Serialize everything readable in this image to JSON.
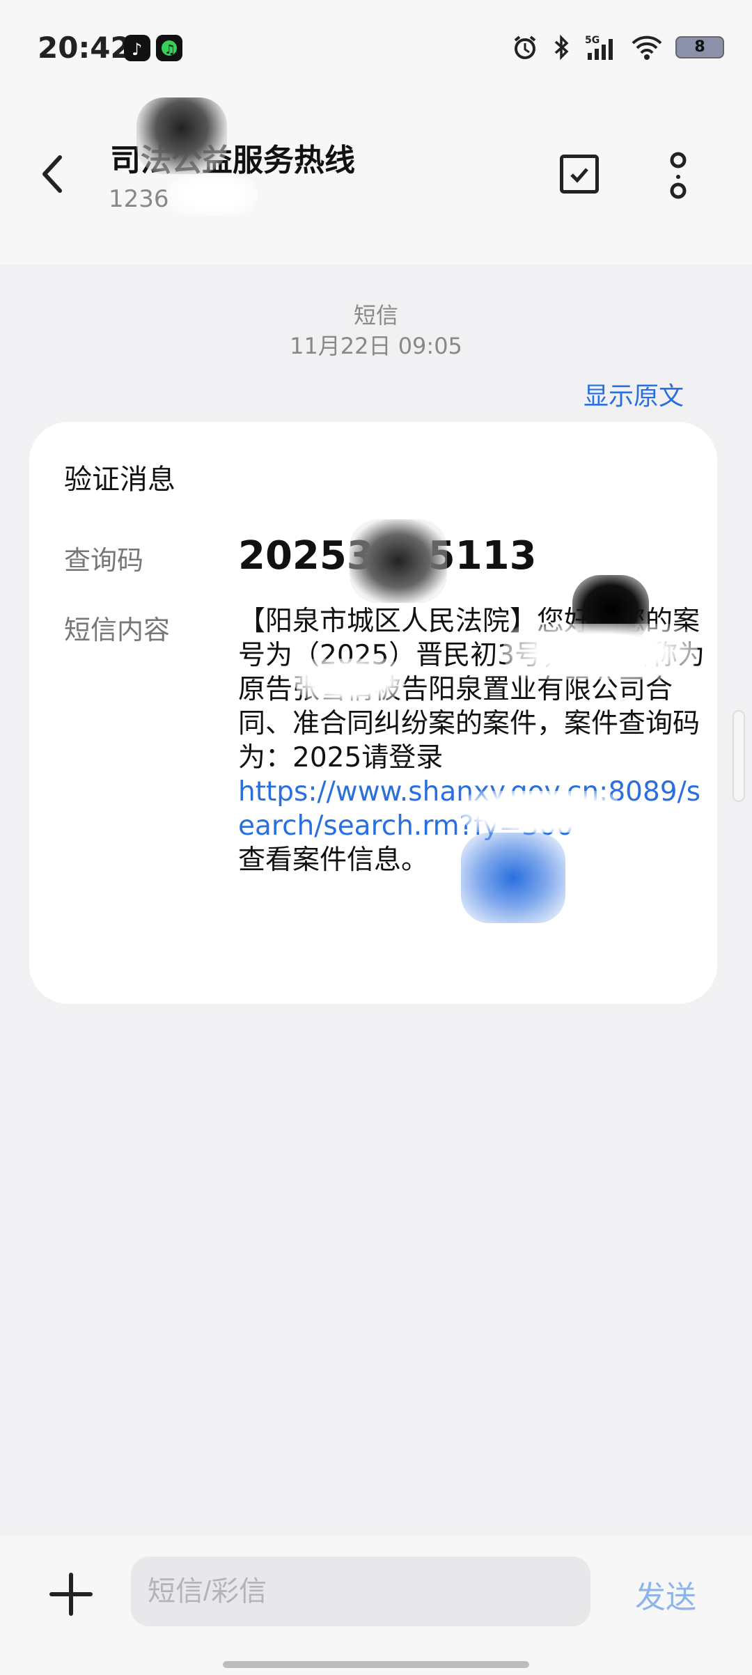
{
  "status_bar": {
    "time": "20:42",
    "battery": "8",
    "icons": [
      "tiktok-app-icon",
      "music-app-icon",
      "alarm-icon",
      "bluetooth-icon",
      "5g-signal-icon",
      "wifi-icon",
      "battery-icon"
    ]
  },
  "header": {
    "title": "司法公益服务热线",
    "number": "1236",
    "back_icon": "chevron-left-icon",
    "actions": [
      "checkbox-icon",
      "more-vertical-icon"
    ]
  },
  "thread": {
    "type_label": "短信",
    "timestamp": "11月22日 09:05",
    "show_original": "显示原文"
  },
  "card": {
    "title": "验证消息",
    "code_label": "查询码",
    "code_value": "20253235113",
    "content_label": "短信内容",
    "content_text": "【阳泉市城区人民法院】您好，您的案号为（2025）晋民初3号，案件名称为原告张雪倩被告阳泉置业有限公司合同、准合同纠纷案的案件，案件查询码为：2025请登录",
    "content_link": "https://www.shanxy.gov.cn:8089/search/search.rm?fy=300",
    "content_tail": "查看案件信息。"
  },
  "composer": {
    "placeholder": "短信/彩信",
    "send_label": "发送"
  },
  "colors": {
    "accent": "#2a6fe0",
    "send_disabled": "#8db5ea",
    "background": "#f1f1f3"
  }
}
